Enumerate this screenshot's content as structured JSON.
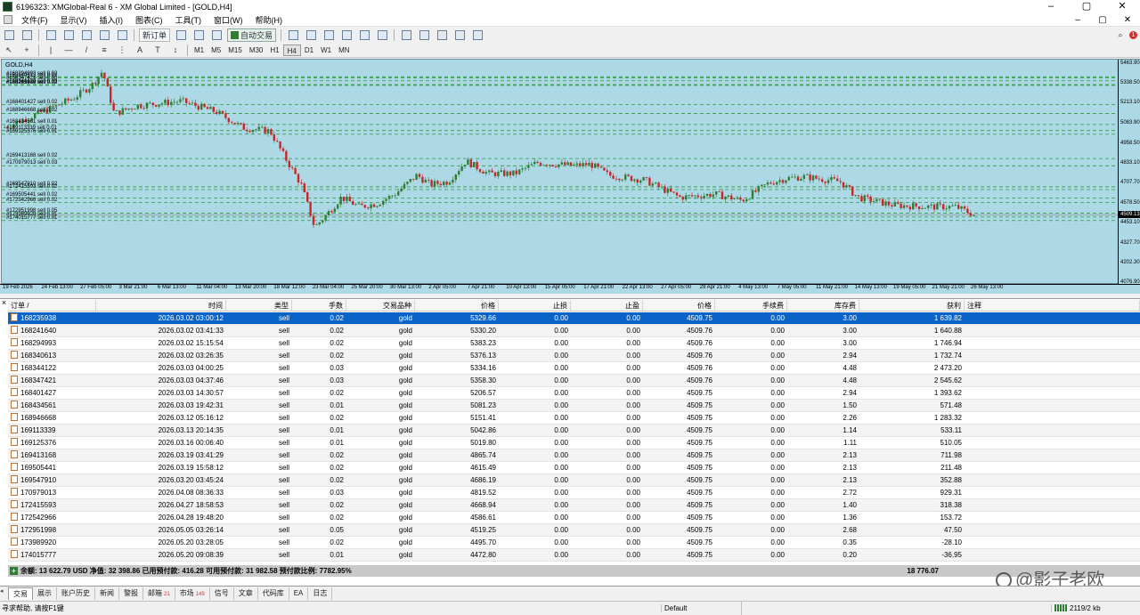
{
  "titlebar": {
    "title": "6196323: XMGlobal-Real 6 - XM Global Limited - [GOLD,H4]",
    "minimize": "–",
    "maximize": "▢",
    "close": "✕"
  },
  "menu": {
    "items": [
      "文件(F)",
      "显示(V)",
      "插入(I)",
      "图表(C)",
      "工具(T)",
      "窗口(W)",
      "帮助(H)"
    ],
    "controls": [
      "–",
      "▢",
      "✕"
    ]
  },
  "toolbar": {
    "new_order": "新订单",
    "auto_trading": "自动交易",
    "timeframes": [
      "M1",
      "M5",
      "M15",
      "M30",
      "H1",
      "H4",
      "D1",
      "W1",
      "MN"
    ],
    "active_timeframe": "H4",
    "notifications": "1"
  },
  "chart": {
    "symbol": "GOLD,H4",
    "background": "#add8e6",
    "bull_color": "#2e7d32",
    "bear_color": "#c62828",
    "current_price": "4509.13",
    "price_ticks": [
      "5463.90",
      "5338.50",
      "5213.10",
      "5083.90",
      "4958.50",
      "4833.10",
      "4707.70",
      "4578.50",
      "4453.10",
      "4327.70",
      "4202.30",
      "4076.90"
    ],
    "time_ticks": [
      "19 Feb 2026",
      "24 Feb 13:00",
      "27 Feb 05:00",
      "3 Mar 21:00",
      "6 Mar 13:00",
      "11 Mar 04:00",
      "13 Mar 20:00",
      "18 Mar 12:00",
      "23 Mar 04:00",
      "25 Mar 20:00",
      "30 Mar 13:00",
      "2 Apr 05:00",
      "7 Apr 21:00",
      "10 Apr 13:00",
      "15 Apr 05:00",
      "17 Apr 21:00",
      "22 Apr 13:00",
      "27 Apr 05:00",
      "29 Apr 21:00",
      "4 May 13:00",
      "7 May 05:00",
      "11 May 21:00",
      "14 May 13:00",
      "19 May 05:00",
      "21 May 21:00",
      "26 May 13:00"
    ],
    "order_labels": [
      "#168235938 sell 0.02",
      "#168241640 sell 0.02",
      "#168294993 sell 0.02",
      "#168340613 sell 0.02",
      "#168344122 sell 0.03",
      "#168347421 sell 0.03",
      "#168401427 sell 0.02",
      "#168434561 sell 0.01",
      "#168946668 sell 0.02",
      "#169113339 sell 0.01",
      "#169125376 sell 0.01",
      "#169413168 sell 0.02",
      "#170979013 sell 0.03",
      "#169547910 sell 0.02",
      "#169505441 sell 0.02",
      "#172415593 sell 0.02",
      "#172542966 sell 0.02",
      "#172951998 sell 0.05",
      "#173989920 sell 0.01",
      "#174015777 sell 0.01"
    ],
    "order_prices": [
      5329.66,
      5330.2,
      5383.23,
      5376.13,
      5334.16,
      5358.3,
      5206.57,
      5081.23,
      5151.41,
      5042.86,
      5019.8,
      4865.74,
      4819.52,
      4686.19,
      4615.49,
      4668.94,
      4586.61,
      4519.25,
      4495.7,
      4472.8
    ]
  },
  "terminal": {
    "close": "×",
    "columns": [
      "订单 /",
      "时间",
      "类型",
      "手数",
      "交易品种",
      "价格",
      "止损",
      "止盈",
      "价格",
      "手续费",
      "库存费",
      "获利",
      "注释"
    ],
    "rows": [
      [
        "168235938",
        "2026.03.02 03:00:12",
        "sell",
        "0.02",
        "gold",
        "5329.66",
        "0.00",
        "0.00",
        "4509.75",
        "0.00",
        "3.00",
        "1 639.82"
      ],
      [
        "168241640",
        "2026.03.02 03:41:33",
        "sell",
        "0.02",
        "gold",
        "5330.20",
        "0.00",
        "0.00",
        "4509.76",
        "0.00",
        "3.00",
        "1 640.88"
      ],
      [
        "168294993",
        "2026.03.02 15:15:54",
        "sell",
        "0.02",
        "gold",
        "5383.23",
        "0.00",
        "0.00",
        "4509.76",
        "0.00",
        "3.00",
        "1 746.94"
      ],
      [
        "168340613",
        "2026.03.02 03:26:35",
        "sell",
        "0.02",
        "gold",
        "5376.13",
        "0.00",
        "0.00",
        "4509.76",
        "0.00",
        "2.94",
        "1 732.74"
      ],
      [
        "168344122",
        "2026.03.03 04:00:25",
        "sell",
        "0.03",
        "gold",
        "5334.16",
        "0.00",
        "0.00",
        "4509.76",
        "0.00",
        "4.48",
        "2 473.20"
      ],
      [
        "168347421",
        "2026.03.03 04:37:46",
        "sell",
        "0.03",
        "gold",
        "5358.30",
        "0.00",
        "0.00",
        "4509.76",
        "0.00",
        "4.48",
        "2 545.62"
      ],
      [
        "168401427",
        "2026.03.03 14:30:57",
        "sell",
        "0.02",
        "gold",
        "5206.57",
        "0.00",
        "0.00",
        "4509.75",
        "0.00",
        "2.94",
        "1 393.62"
      ],
      [
        "168434561",
        "2026.03.03 19:42:31",
        "sell",
        "0.01",
        "gold",
        "5081.23",
        "0.00",
        "0.00",
        "4509.75",
        "0.00",
        "1.50",
        "571.48"
      ],
      [
        "168946668",
        "2026.03.12 05:16:12",
        "sell",
        "0.02",
        "gold",
        "5151.41",
        "0.00",
        "0.00",
        "4509.75",
        "0.00",
        "2.26",
        "1 283.32"
      ],
      [
        "169113339",
        "2026.03.13 20:14:35",
        "sell",
        "0.01",
        "gold",
        "5042.86",
        "0.00",
        "0.00",
        "4509.75",
        "0.00",
        "1.14",
        "533.11"
      ],
      [
        "169125376",
        "2026.03.16 00:06:40",
        "sell",
        "0.01",
        "gold",
        "5019.80",
        "0.00",
        "0.00",
        "4509.75",
        "0.00",
        "1.11",
        "510.05"
      ],
      [
        "169413168",
        "2026.03.19 03:41:29",
        "sell",
        "0.02",
        "gold",
        "4865.74",
        "0.00",
        "0.00",
        "4509.75",
        "0.00",
        "2.13",
        "711.98"
      ],
      [
        "169505441",
        "2026.03.19 15:58:12",
        "sell",
        "0.02",
        "gold",
        "4615.49",
        "0.00",
        "0.00",
        "4509.75",
        "0.00",
        "2.13",
        "211.48"
      ],
      [
        "169547910",
        "2026.03.20 03:45:24",
        "sell",
        "0.02",
        "gold",
        "4686.19",
        "0.00",
        "0.00",
        "4509.75",
        "0.00",
        "2.13",
        "352.88"
      ],
      [
        "170979013",
        "2026.04.08 08:36:33",
        "sell",
        "0.03",
        "gold",
        "4819.52",
        "0.00",
        "0.00",
        "4509.75",
        "0.00",
        "2.72",
        "929.31"
      ],
      [
        "172415593",
        "2026.04.27 18:58:53",
        "sell",
        "0.02",
        "gold",
        "4668.94",
        "0.00",
        "0.00",
        "4509.75",
        "0.00",
        "1.40",
        "318.38"
      ],
      [
        "172542966",
        "2026.04.28 19:48:20",
        "sell",
        "0.02",
        "gold",
        "4586.61",
        "0.00",
        "0.00",
        "4509.75",
        "0.00",
        "1.36",
        "153.72"
      ],
      [
        "172951998",
        "2026.05.05 03:26:14",
        "sell",
        "0.05",
        "gold",
        "4519.25",
        "0.00",
        "0.00",
        "4509.75",
        "0.00",
        "2.68",
        "47.50"
      ],
      [
        "173989920",
        "2026.05.20 03:28:05",
        "sell",
        "0.02",
        "gold",
        "4495.70",
        "0.00",
        "0.00",
        "4509.75",
        "0.00",
        "0.35",
        "-28.10"
      ],
      [
        "174015777",
        "2026.05.20 09:08:39",
        "sell",
        "0.01",
        "gold",
        "4472.80",
        "0.00",
        "0.00",
        "4509.75",
        "0.00",
        "0.20",
        "-36.95"
      ]
    ],
    "summary_icon": "+",
    "summary": "余额: 13 622.79 USD  净值: 32 398.86  已用预付款: 416.28  可用预付款: 31 982.58  预付款比例: 7782.95%",
    "summary_total": "18 776.07"
  },
  "tabs": {
    "items": [
      {
        "label": "交易",
        "badge": ""
      },
      {
        "label": "展示",
        "badge": ""
      },
      {
        "label": "账户历史",
        "badge": ""
      },
      {
        "label": "新闻",
        "badge": ""
      },
      {
        "label": "警报",
        "badge": ""
      },
      {
        "label": "邮箱",
        "badge": "21"
      },
      {
        "label": "市场",
        "badge": "149"
      },
      {
        "label": "信号",
        "badge": ""
      },
      {
        "label": "文章",
        "badge": ""
      },
      {
        "label": "代码库",
        "badge": ""
      },
      {
        "label": "EA",
        "badge": ""
      },
      {
        "label": "日志",
        "badge": ""
      }
    ],
    "active": "交易"
  },
  "watermark": "@影子老欧",
  "status": {
    "help": "寻求帮助, 请按F1键",
    "profile": "Default",
    "traffic": "2119/2 kb"
  }
}
